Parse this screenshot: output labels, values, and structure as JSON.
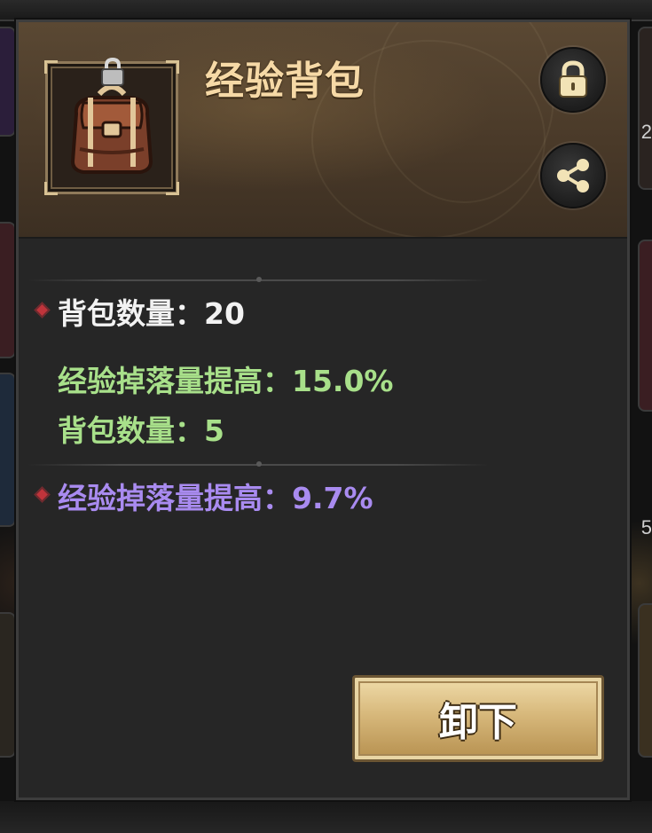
{
  "item": {
    "name": "经验背包",
    "icon": "backpack-icon",
    "locked_badge_icon": "padlock-icon"
  },
  "header_actions": {
    "lock_icon": "lock-icon",
    "share_icon": "share-icon"
  },
  "stats": {
    "base": "背包数量：20",
    "bonus": [
      "经验掉落量提高：15.0%",
      "背包数量：5"
    ],
    "random": "经验掉落量提高：9.7%"
  },
  "actions": {
    "unequip_label": "卸下"
  },
  "colors": {
    "title": "#f6d9a6",
    "stat_white": "#f2f2f2",
    "stat_green": "#a8e08a",
    "stat_purple": "#a98bf0",
    "button_gold": "#d7b87b"
  },
  "background": {
    "right_edge_digits": [
      "2",
      "5"
    ]
  }
}
